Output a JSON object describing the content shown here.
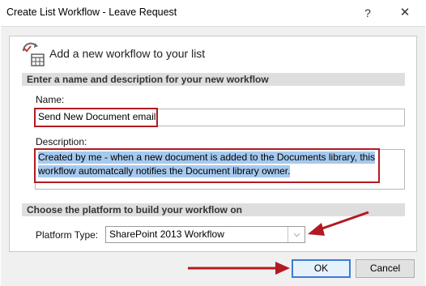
{
  "window": {
    "title": "Create List Workflow - Leave Request",
    "help_label": "?",
    "close_label": "✕"
  },
  "header": {
    "text": "Add a new workflow to your list",
    "icon": "workflow-icon"
  },
  "section_name": {
    "title": "Enter a name and description for your new workflow"
  },
  "name_field": {
    "label": "Name:",
    "value": "Send New Document email"
  },
  "description_field": {
    "label": "Description:",
    "line1": "Created by me - when a new document is added to the Documents library, this",
    "line2": "workflow automatcally notifies the Document library owner."
  },
  "section_platform": {
    "title": "Choose the platform to build your workflow on"
  },
  "platform": {
    "label": "Platform Type:",
    "selected": "SharePoint 2013 Workflow"
  },
  "buttons": {
    "ok": "OK",
    "cancel": "Cancel"
  },
  "colors": {
    "highlight_border": "#b21a22",
    "selection": "#a6c9ee",
    "ok_border": "#3c7bd4"
  }
}
